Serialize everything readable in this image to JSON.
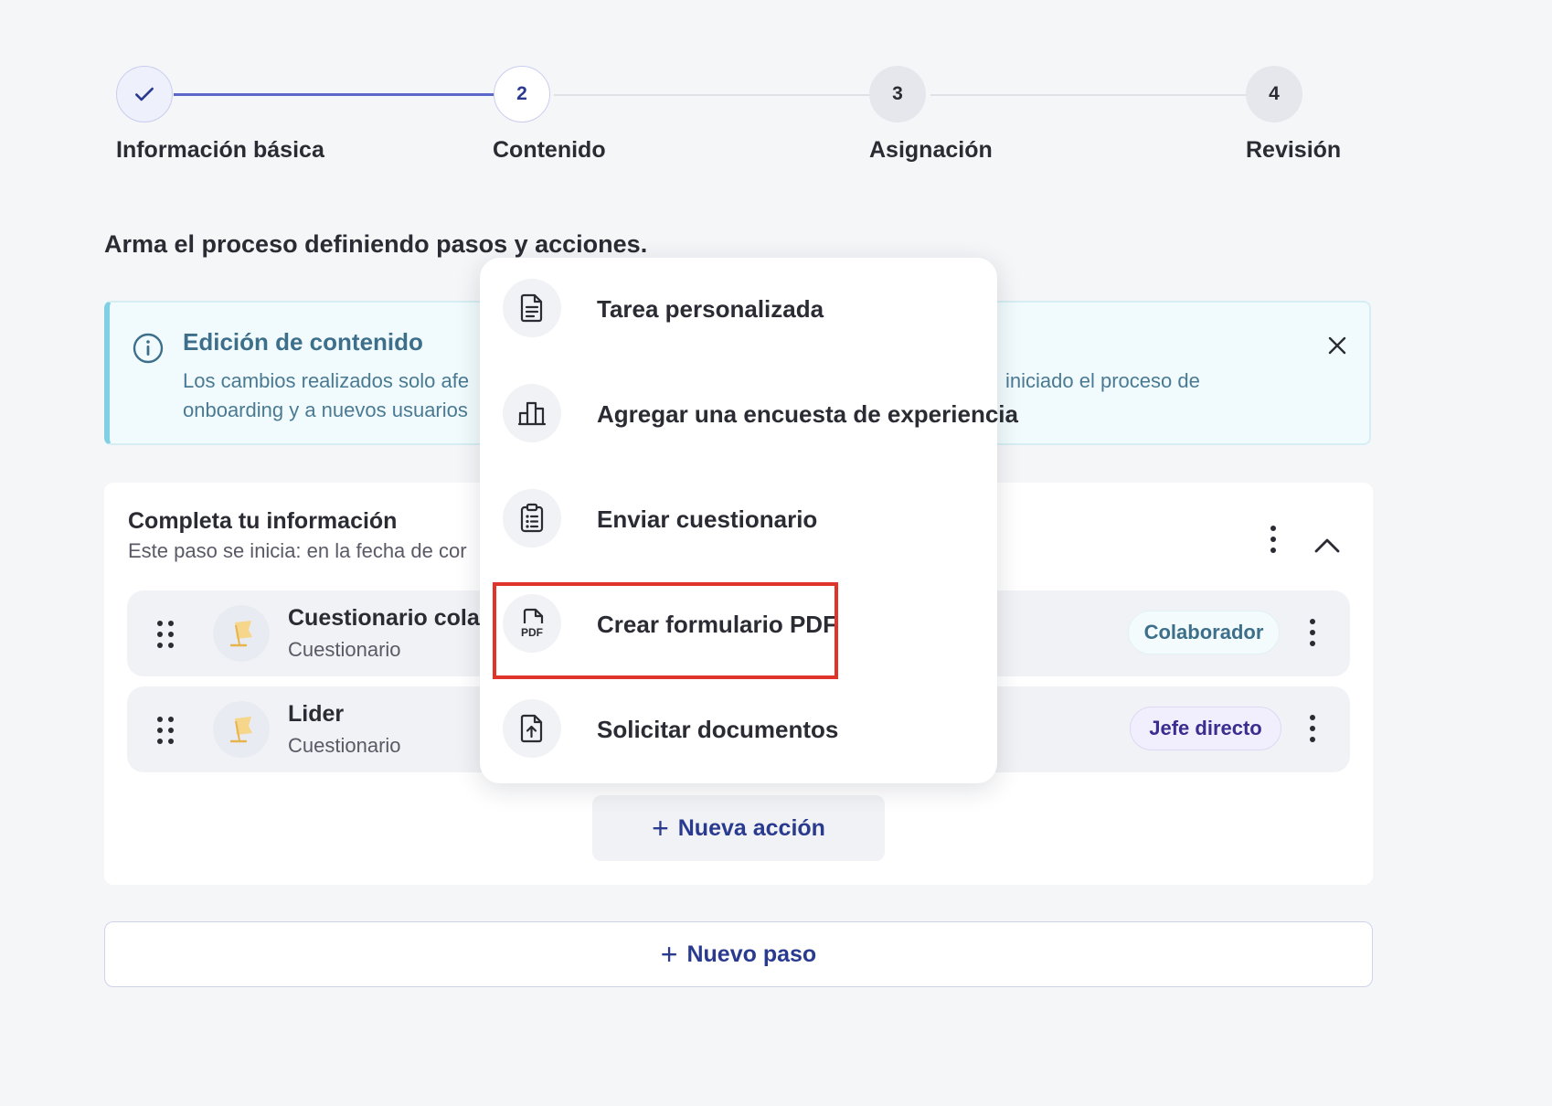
{
  "stepper": {
    "steps": [
      {
        "label": "Información básica",
        "number": "1",
        "state": "done"
      },
      {
        "label": "Contenido",
        "number": "2",
        "state": "active"
      },
      {
        "label": "Asignación",
        "number": "3",
        "state": "todo"
      },
      {
        "label": "Revisión",
        "number": "4",
        "state": "todo"
      }
    ]
  },
  "main": {
    "subtitle": "Arma el proceso definiendo pasos y acciones."
  },
  "banner": {
    "title": "Edición de contenido",
    "text_left_line1": "Los cambios realizados solo afe",
    "text_left_line2": "onboarding y a nuevos usuarios",
    "text_right_line1": "iniciado el proceso de"
  },
  "step_card": {
    "title": "Completa tu información",
    "subtitle": "Este paso se inicia: en la fecha de cor",
    "rows": [
      {
        "title": "Cuestionario colab",
        "subtitle": "Cuestionario",
        "badge": "Colaborador"
      },
      {
        "title": "Lider",
        "subtitle": "Cuestionario",
        "badge": "Jefe directo"
      }
    ],
    "new_action_label": "Nueva acción"
  },
  "new_step_label": "Nuevo paso",
  "menu": {
    "items": [
      {
        "label": "Tarea personalizada",
        "icon": "document-icon"
      },
      {
        "label": "Agregar una encuesta de experiencia",
        "icon": "bar-chart-icon"
      },
      {
        "label": "Enviar cuestionario",
        "icon": "clipboard-list-icon"
      },
      {
        "label": "Crear formulario PDF",
        "icon": "pdf-file-icon",
        "icon_text": "PDF"
      },
      {
        "label": "Solicitar documentos",
        "icon": "file-upload-icon"
      }
    ]
  },
  "colors": {
    "accent": "#2a3a8f",
    "progress": "#5b68c9",
    "highlight": "#e0342a",
    "banner_border": "#7fd0e2"
  }
}
